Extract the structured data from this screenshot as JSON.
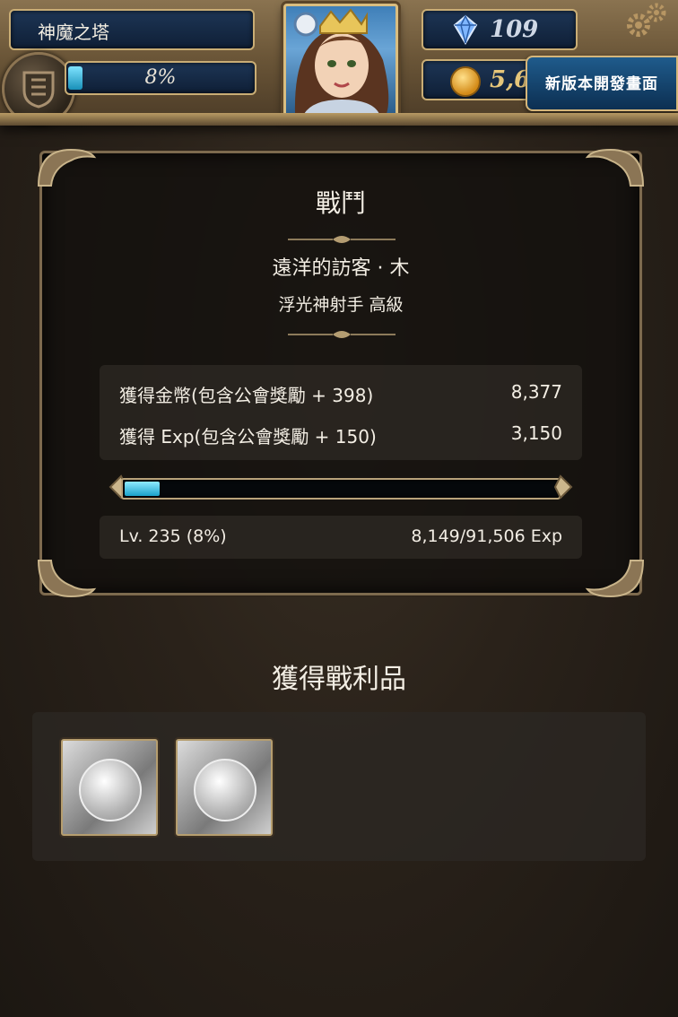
{
  "hud": {
    "stage_name": "神魔之塔",
    "exp_percent_label": "8%",
    "exp_fraction": 0.08,
    "diamonds": "109",
    "gold": "5,6",
    "news_button_label": "新版本開發畫面"
  },
  "battle": {
    "title": "戰鬥",
    "stage_name": "遠洋的訪客 · 木",
    "difficulty": "浮光神射手 高級",
    "rewards": [
      {
        "label": "獲得金幣(包含公會獎勵 + 398)",
        "value": "8,377"
      },
      {
        "label": "獲得 Exp(包含公會獎勵 + 150)",
        "value": "3,150"
      }
    ],
    "level_fraction": 0.08,
    "level_text": "Lv. 235 (8%)",
    "exp_text": "8,149/91,506 Exp"
  },
  "loot": {
    "title": "獲得戰利品",
    "items": [
      {
        "icon": "silver-coin-card-icon"
      },
      {
        "icon": "silver-coin-card-icon"
      }
    ]
  },
  "colors": {
    "accent_blue": "#1aa2c9",
    "frame_gold": "#c9ad75"
  }
}
